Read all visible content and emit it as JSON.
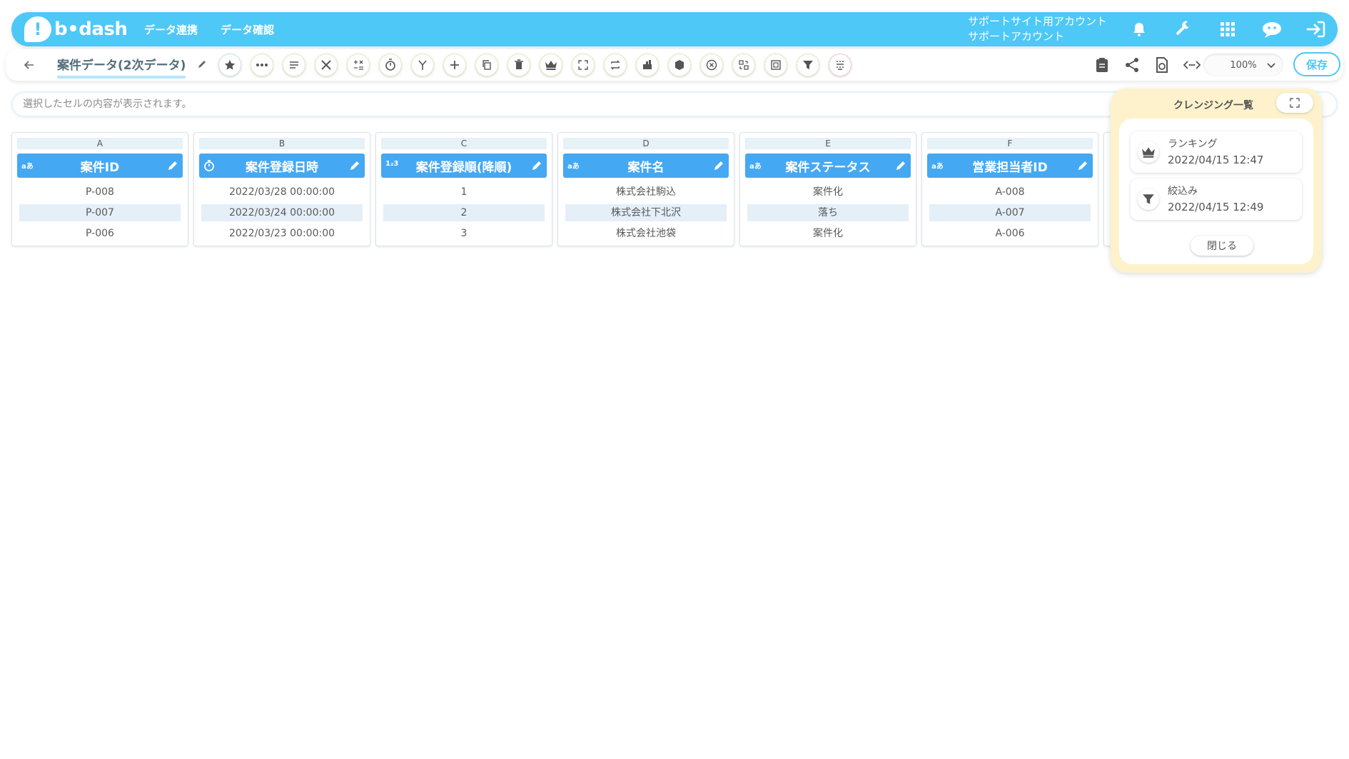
{
  "header": {
    "logo_text": "b•dash",
    "nav": [
      "データ連携",
      "データ確認"
    ],
    "account_line1": "サポートサイト用アカウント",
    "account_line2": "サポートアカウント",
    "icons": [
      "bell-icon",
      "wrench-icon",
      "grid-icon",
      "chat-robot-icon",
      "logout-icon"
    ]
  },
  "toolbar": {
    "back_icon": "arrow-left-icon",
    "title": "案件データ(2次データ)",
    "tools": [
      {
        "name": "favorite",
        "icon": "star-icon"
      },
      {
        "name": "more",
        "icon": "dots-icon"
      },
      {
        "name": "list",
        "icon": "lines-icon"
      },
      {
        "name": "cleansing",
        "icon": "tools-icon"
      },
      {
        "name": "calc",
        "icon": "calc-icon"
      },
      {
        "name": "timer",
        "icon": "timer-icon"
      },
      {
        "name": "merge",
        "icon": "merge-icon"
      },
      {
        "name": "add",
        "icon": "plus-icon"
      },
      {
        "name": "copy",
        "icon": "copy-icon"
      },
      {
        "name": "delete",
        "icon": "trash-icon"
      },
      {
        "name": "ranking",
        "icon": "crown-icon"
      },
      {
        "name": "expand",
        "icon": "expand-icon"
      },
      {
        "name": "convert",
        "icon": "repeat-icon"
      },
      {
        "name": "aggregate",
        "icon": "chart-icon"
      },
      {
        "name": "box",
        "icon": "box-icon"
      },
      {
        "name": "cancel",
        "icon": "x-circle-icon"
      },
      {
        "name": "replace",
        "icon": "replace-icon"
      },
      {
        "name": "frame",
        "icon": "frame-icon"
      },
      {
        "name": "filter",
        "icon": "filter-icon"
      },
      {
        "name": "grid",
        "icon": "grid-dots-icon"
      }
    ],
    "right_icons": [
      "clipboard-icon",
      "share-icon",
      "refresh-doc-icon",
      "code-icon"
    ],
    "zoom": "100%",
    "save_label": "保存"
  },
  "cellbar": {
    "placeholder": "選択したセルの内容が表示されます。"
  },
  "columns": [
    {
      "letter": "A",
      "type": "aあ",
      "name": "案件ID",
      "rows": [
        "P-008",
        "P-007",
        "P-006"
      ]
    },
    {
      "letter": "B",
      "type": "clock",
      "name": "案件登録日時",
      "rows": [
        "2022/03/28 00:00:00",
        "2022/03/24 00:00:00",
        "2022/03/23 00:00:00"
      ]
    },
    {
      "letter": "C",
      "type": "1₂3",
      "name": "案件登録順(降順)",
      "rows": [
        "1",
        "2",
        "3"
      ]
    },
    {
      "letter": "D",
      "type": "aあ",
      "name": "案件名",
      "rows": [
        "株式会社駒込",
        "株式会社下北沢",
        "株式会社池袋"
      ]
    },
    {
      "letter": "E",
      "type": "aあ",
      "name": "案件ステータス",
      "rows": [
        "案件化",
        "落ち",
        "案件化"
      ]
    },
    {
      "letter": "F",
      "type": "aあ",
      "name": "営業担当者ID",
      "rows": [
        "A-008",
        "A-007",
        "A-006"
      ]
    }
  ],
  "panel": {
    "title": "クレンジング一覧",
    "history": [
      {
        "name": "ランキング",
        "time": "2022/04/15 12:47",
        "icon": "crown-icon"
      },
      {
        "name": "絞込み",
        "time": "2022/04/15 12:49",
        "icon": "filter-icon"
      }
    ],
    "close_label": "閉じる"
  },
  "colors": {
    "brand": "#4ec8f7",
    "column_header": "#45a8f2",
    "panel_bg": "#fdf2cc"
  }
}
